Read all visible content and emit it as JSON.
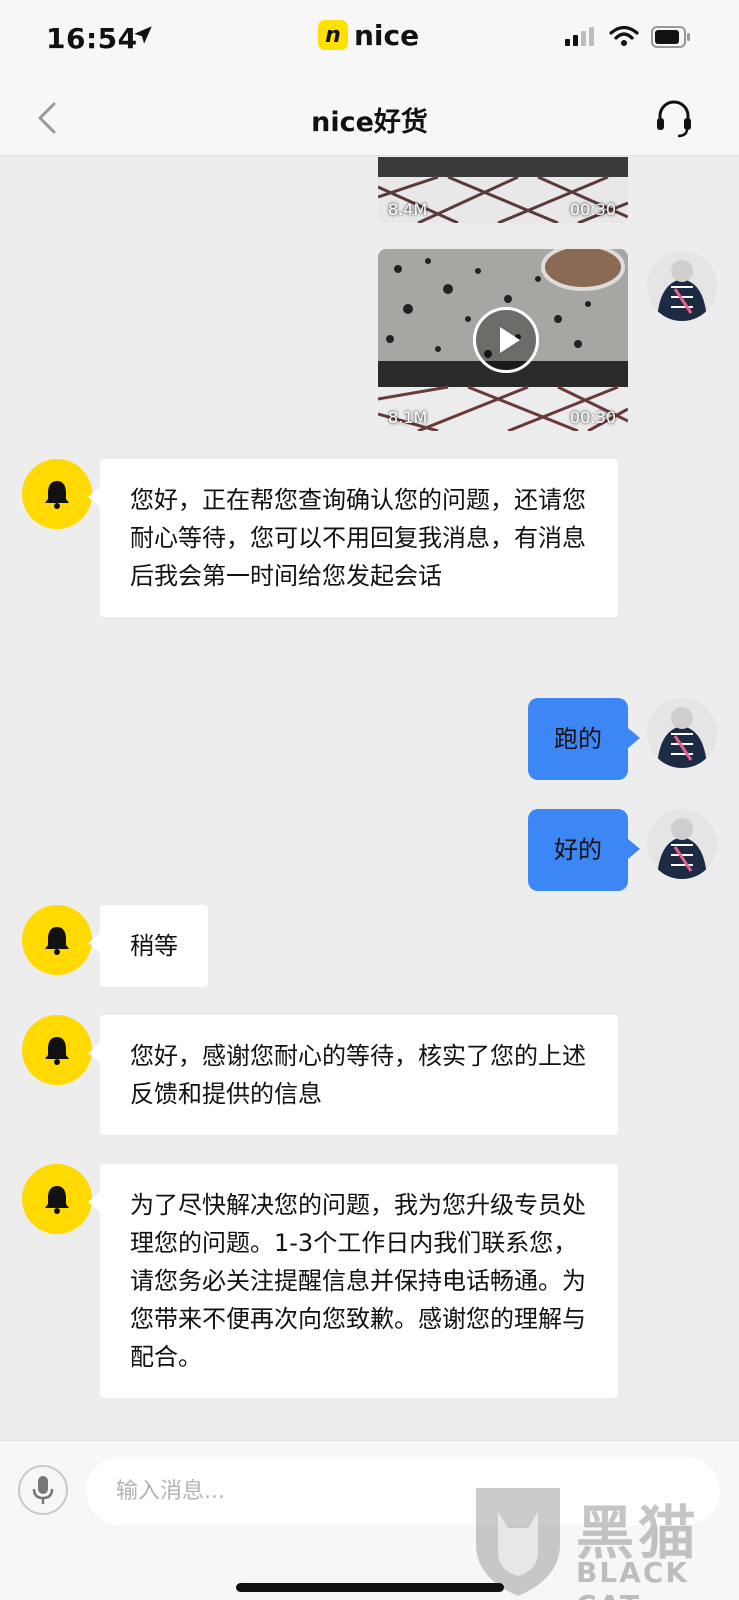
{
  "status_bar": {
    "time": "16:54",
    "app_badge": "n",
    "app_name": "nice"
  },
  "header": {
    "title": "nice好货"
  },
  "videos": [
    {
      "size": "8.4M",
      "duration": "00:30"
    },
    {
      "size": "8.1M",
      "duration": "00:30"
    }
  ],
  "messages": {
    "m1": "您好，正在帮您查询确认您的问题，还请您耐心等待，您可以不用回复我消息，有消息后我会第一时间给您发起会话",
    "m2": "跑的",
    "m3": "好的",
    "m4": "稍等",
    "m5": "您好，感谢您耐心的等待，核实了您的上述反馈和提供的信息",
    "m6": "为了尽快解决您的问题，我为您升级专员处理您的问题。1-3个工作日内我们联系您，请您务必关注提醒信息并保持电话畅通。为您带来不便再次向您致歉。感谢您的理解与配合。"
  },
  "input": {
    "placeholder": "输入消息..."
  },
  "watermark": {
    "main": "黑猫",
    "sub": "BLACK CAT"
  },
  "colors": {
    "brand": "#ffd900",
    "outgoing_bubble": "#3d86f5",
    "background": "#ededed"
  }
}
